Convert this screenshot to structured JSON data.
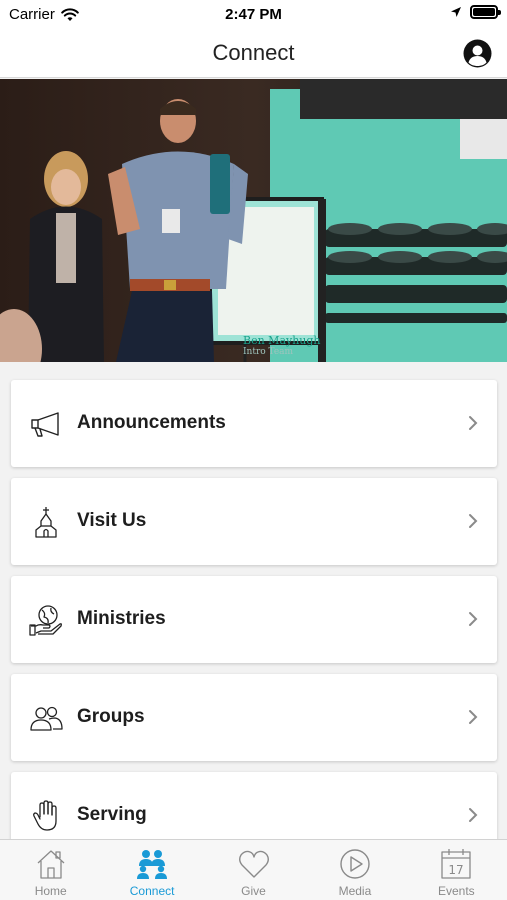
{
  "status_bar": {
    "carrier": "Carrier",
    "time": "2:47 PM"
  },
  "nav": {
    "title": "Connect",
    "profile_icon": "user-circle-icon"
  },
  "hero": {
    "sign_text": "Ben Mayhugh",
    "sign_subtext": "Intro Team"
  },
  "menu": {
    "items": [
      {
        "label": "Announcements",
        "icon": "megaphone-icon"
      },
      {
        "label": "Visit Us",
        "icon": "church-icon"
      },
      {
        "label": "Ministries",
        "icon": "globe-hand-icon"
      },
      {
        "label": "Groups",
        "icon": "users-icon"
      },
      {
        "label": "Serving",
        "icon": "hand-icon"
      }
    ]
  },
  "tabs": [
    {
      "label": "Home",
      "icon": "home-icon",
      "active": false
    },
    {
      "label": "Connect",
      "icon": "people-icon",
      "active": true
    },
    {
      "label": "Give",
      "icon": "heart-icon",
      "active": false
    },
    {
      "label": "Media",
      "icon": "play-circle-icon",
      "active": false
    },
    {
      "label": "Events",
      "icon": "calendar-icon",
      "active": false,
      "calendar_day": "17"
    }
  ],
  "colors": {
    "accent": "#1a9ad6",
    "tab_inactive": "#8a8a8a",
    "hero_teal": "#5fc9b4"
  }
}
